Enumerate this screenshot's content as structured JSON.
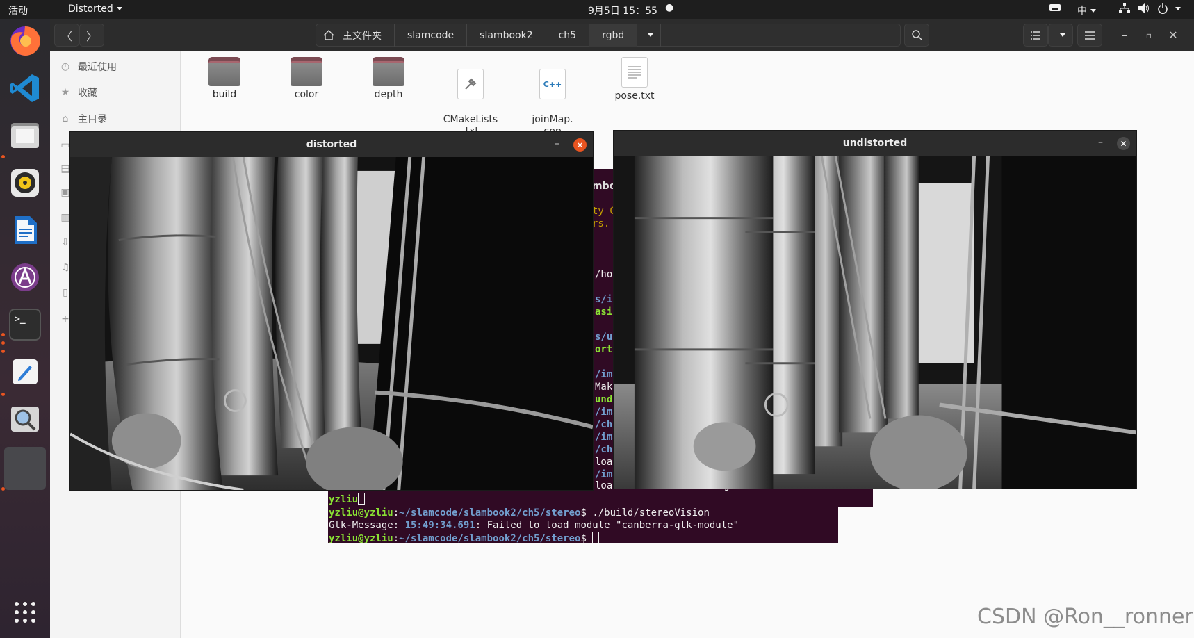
{
  "topbar": {
    "activities": "活动",
    "app_menu": "Distorted",
    "clock": "9月5日  15：55",
    "input_method": "中"
  },
  "dock": {
    "items": [
      "firefox-icon",
      "vscode-icon",
      "files-icon",
      "rhythmbox-icon",
      "writer-icon",
      "software-icon",
      "terminal-icon",
      "text-editor-icon",
      "image-viewer-icon",
      "window-icon"
    ],
    "terminal_glyph": ">_",
    "cpp_glyph": "C++"
  },
  "file_manager": {
    "breadcrumbs": [
      "主文件夹",
      "slamcode",
      "slambook2",
      "ch5",
      "rgbd"
    ],
    "sidebar": [
      "最近使用",
      "收藏",
      "主目录"
    ],
    "files": [
      {
        "name": "build",
        "type": "folder"
      },
      {
        "name": "color",
        "type": "folder"
      },
      {
        "name": "depth",
        "type": "folder"
      },
      {
        "name": "CMakeLists\n.txt",
        "type": "cmake"
      },
      {
        "name": "joinMap.\ncpp",
        "type": "cpp"
      },
      {
        "name": "pose.txt",
        "type": "text"
      }
    ]
  },
  "terminal": {
    "partial_lines": [
      "ty C",
      "rs.",
      "/ho",
      "s/in",
      "asic",
      "s/un",
      "ortI",
      "/ima",
      "Mak",
      "und",
      "/ima",
      "/ch5",
      "/ima",
      "/ch5",
      "loa",
      "/ima",
      "load module \"canberra-gtk-module\""
    ],
    "partial_title": "mboo",
    "prompt_user": "yzliu@yzliu",
    "prompt_path": "~/slamcode/slambook2/ch5/stereo",
    "prompt_head": "yzliu",
    "command": "./build/stereoVision",
    "gtk_label": "Gtk-Message",
    "gtk_time": "15:49:34.691",
    "gtk_msg": ": Failed to load module \"canberra-gtk-module\""
  },
  "windows": {
    "distorted_title": "distorted",
    "undistorted_title": "undistorted"
  },
  "watermark": "CSDN @Ron__ronner"
}
